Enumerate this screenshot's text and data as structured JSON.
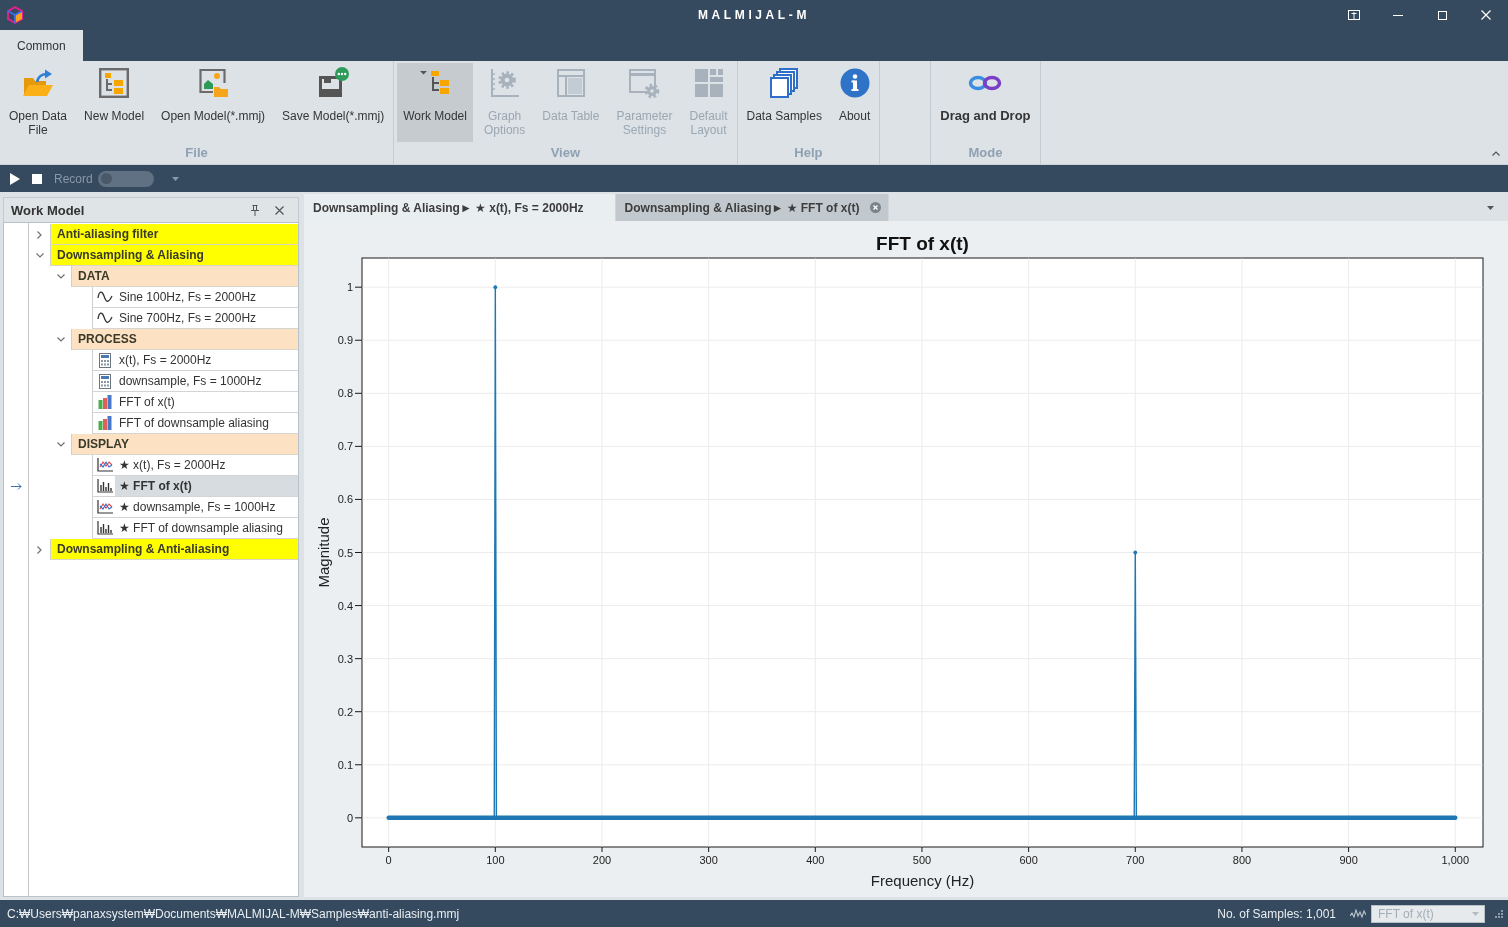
{
  "window": {
    "title": "MALMIJAL-M"
  },
  "ribbon": {
    "tabs": [
      {
        "label": "Common",
        "selected": true
      }
    ],
    "groups": [
      {
        "label": "File",
        "buttons": [
          {
            "label": "Open Data\nFile",
            "kind": "command",
            "pressed": false,
            "disabled": false
          },
          {
            "label": "New Model",
            "kind": "command",
            "pressed": false,
            "disabled": false
          },
          {
            "label": "Open Model(*.mmj)",
            "kind": "command",
            "pressed": false,
            "disabled": false
          },
          {
            "label": "Save Model(*.mmj)",
            "kind": "command",
            "pressed": false,
            "disabled": false
          }
        ]
      },
      {
        "label": "View",
        "buttons": [
          {
            "label": "Work Model",
            "kind": "command",
            "pressed": true,
            "disabled": false
          },
          {
            "label": "Graph\nOptions",
            "kind": "command",
            "pressed": false,
            "disabled": true
          },
          {
            "label": "Data Table",
            "kind": "command",
            "pressed": false,
            "disabled": true
          },
          {
            "label": "Parameter\nSettings",
            "kind": "command",
            "pressed": false,
            "disabled": true
          },
          {
            "label": "Default\nLayout",
            "kind": "command",
            "pressed": false,
            "disabled": true
          }
        ]
      },
      {
        "label": "Help",
        "buttons": [
          {
            "label": "Data Samples",
            "kind": "command",
            "pressed": false,
            "disabled": false
          },
          {
            "label": "About",
            "kind": "command",
            "pressed": false,
            "disabled": false
          }
        ]
      },
      {
        "label": "Mode",
        "buttons": [
          {
            "label": "Drag and Drop",
            "kind": "mode",
            "pressed": false,
            "disabled": false
          }
        ]
      }
    ]
  },
  "toolbar": {
    "record": {
      "label": "Record",
      "on": false
    }
  },
  "work_model": {
    "title": "Work Model",
    "tree": [
      {
        "label": "Anti-aliasing filter",
        "kind": "group",
        "expanded": false,
        "selected": false
      },
      {
        "label": "Downsampling & Aliasing",
        "kind": "group",
        "expanded": true,
        "selected": false,
        "children": [
          {
            "label": "DATA",
            "kind": "category",
            "expanded": true,
            "selected": false,
            "children": [
              {
                "label": "Sine 100Hz, Fs = 2000Hz",
                "kind": "signal",
                "selected": false
              },
              {
                "label": "Sine 700Hz, Fs = 2000Hz",
                "kind": "signal",
                "selected": false
              }
            ]
          },
          {
            "label": "PROCESS",
            "kind": "category",
            "expanded": true,
            "selected": false,
            "children": [
              {
                "label": "x(t), Fs = 2000Hz",
                "kind": "calculation",
                "selected": false
              },
              {
                "label": "downsample, Fs = 1000Hz",
                "kind": "calculation",
                "selected": false
              },
              {
                "label": "FFT of x(t)",
                "kind": "spectrum",
                "selected": false
              },
              {
                "label": "FFT of downsample aliasing",
                "kind": "spectrum",
                "selected": false
              }
            ]
          },
          {
            "label": "DISPLAY",
            "kind": "category",
            "expanded": true,
            "selected": false,
            "children": [
              {
                "label": "★ x(t), Fs = 2000Hz",
                "kind": "line-plot",
                "selected": false
              },
              {
                "label": "★ FFT of x(t)",
                "kind": "bar-plot",
                "selected": true
              },
              {
                "label": "★ downsample, Fs = 1000Hz",
                "kind": "line-plot",
                "selected": false
              },
              {
                "label": "★ FFT of downsample aliasing",
                "kind": "bar-plot",
                "selected": false
              }
            ]
          }
        ]
      },
      {
        "label": "Downsampling & Anti-aliasing",
        "kind": "group",
        "expanded": false,
        "selected": false
      }
    ]
  },
  "document_tabs": [
    {
      "label": "Downsampling & Aliasing► ★ x(t), Fs = 2000Hz",
      "selected": false
    },
    {
      "label": "Downsampling & Aliasing► ★ FFT of x(t)",
      "selected": true
    }
  ],
  "chart": {
    "chart_data": {
      "type": "line",
      "title": "FFT of x(t)",
      "xlabel": "Frequency (Hz)",
      "ylabel": "Magnitude",
      "x": [
        0,
        99,
        100,
        101,
        699,
        700,
        701,
        1000
      ],
      "series": [
        {
          "color": "#1f77b4",
          "values": [
            0,
            0,
            1,
            0,
            0,
            0.5,
            0,
            0
          ]
        }
      ],
      "xlim": [
        -25,
        1026
      ],
      "ylim": [
        -0.055,
        1.055
      ],
      "xticks": [
        0,
        100,
        200,
        300,
        400,
        500,
        600,
        700,
        800,
        900,
        {
          "value": 1000,
          "label": "1,000"
        }
      ],
      "yticks": [
        0,
        0.1,
        0.2,
        0.3,
        0.4,
        0.5,
        0.6,
        0.7,
        0.8,
        0.9,
        1
      ],
      "grid": true
    }
  },
  "status_bar": {
    "path": "C:₩Users₩panaxsystem₩Documents₩MALMIJAL-M₩Samples₩anti-aliasing.mmj",
    "samples": "No. of Samples: 1,001",
    "view_select": {
      "value": "FFT of x(t)",
      "disabled": true
    }
  }
}
